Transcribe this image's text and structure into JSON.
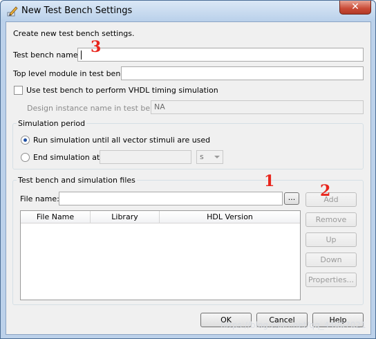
{
  "window": {
    "title": "New Test Bench Settings",
    "close_symbol": "✕"
  },
  "intro": "Create new test bench settings.",
  "test_bench_name": {
    "label": "Test bench name:",
    "value": ""
  },
  "top_level_module": {
    "label": "Top level module in test bench:",
    "value": ""
  },
  "vhdl_timing": {
    "label": "Use test bench to perform VHDL timing simulation",
    "checked": false
  },
  "design_instance": {
    "label": "Design instance name in test bench:",
    "value": "NA"
  },
  "simulation_period": {
    "title": "Simulation period",
    "run_until_label": "Run simulation until all vector stimuli are used",
    "end_at_label": "End simulation at:",
    "end_at_value": "",
    "unit": "s"
  },
  "files_group": {
    "title": "Test bench and simulation files",
    "file_name_label": "File name:",
    "file_name_value": "",
    "browse_label": "...",
    "add_label": "Add",
    "remove_label": "Remove",
    "up_label": "Up",
    "down_label": "Down",
    "properties_label": "Properties...",
    "columns": [
      "File Name",
      "Library",
      "HDL Version"
    ]
  },
  "buttons": {
    "ok": "OK",
    "cancel": "Cancel",
    "help": "Help"
  },
  "annotations": [
    "1",
    "2",
    "3"
  ],
  "watermark": "https://blog.csdn.net/qq_44007021"
}
